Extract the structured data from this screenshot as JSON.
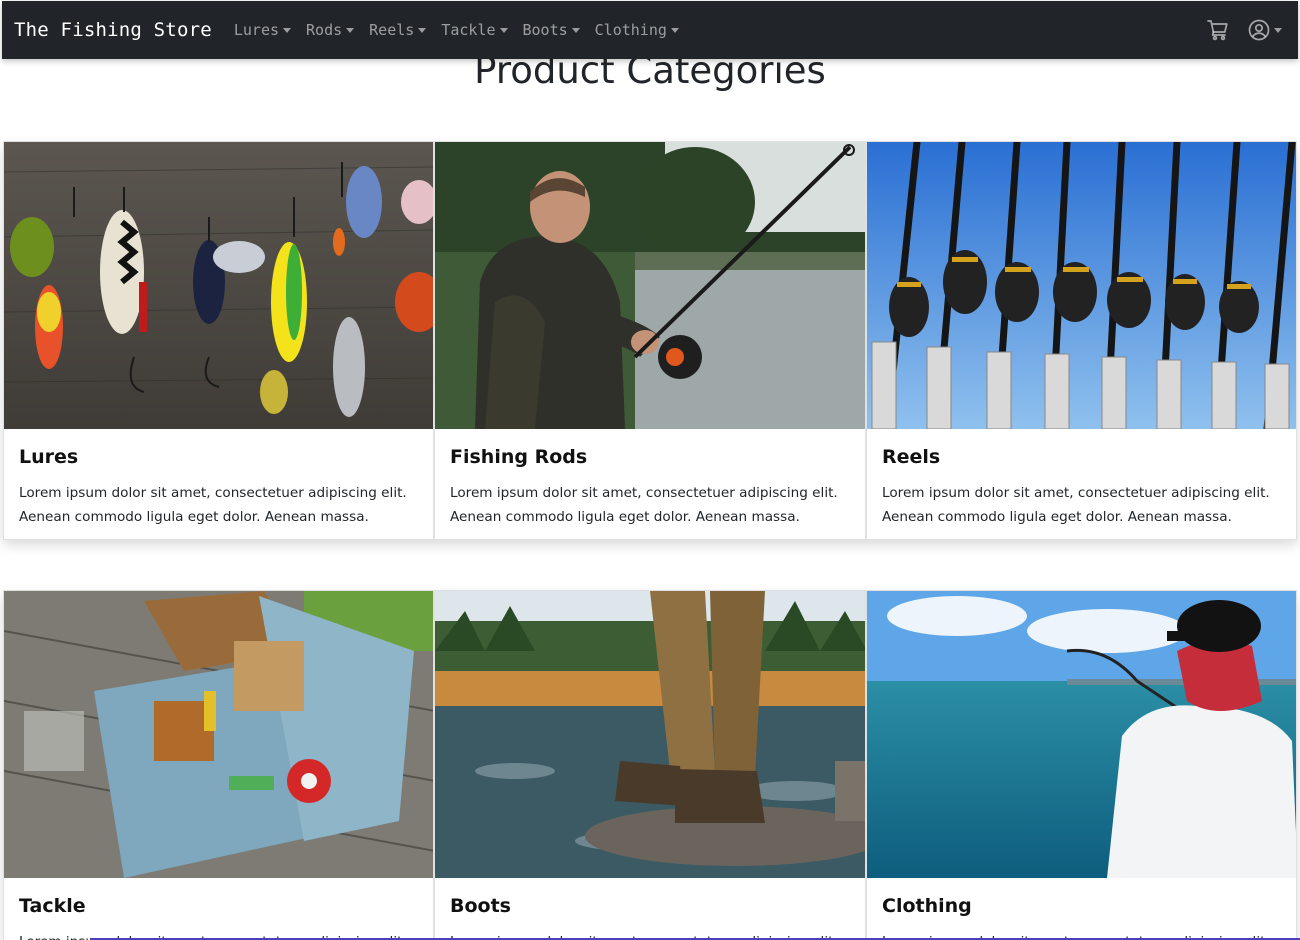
{
  "navbar": {
    "brand": "The Fishing Store",
    "menu": [
      {
        "label": "Lures"
      },
      {
        "label": "Rods"
      },
      {
        "label": "Reels"
      },
      {
        "label": "Tackle"
      },
      {
        "label": "Boots"
      },
      {
        "label": "Clothing"
      }
    ],
    "cart_icon": "cart-icon",
    "account_icon": "user-circle-icon"
  },
  "main": {
    "heading": "Product Categories",
    "categories": [
      {
        "title": "Lures",
        "text": "Lorem ipsum dolor sit amet, consectetuer adipiscing elit. Aenean commodo ligula eget dolor. Aenean massa.",
        "image": "lures-photo"
      },
      {
        "title": "Fishing Rods",
        "text": "Lorem ipsum dolor sit amet, consectetuer adipiscing elit. Aenean commodo ligula eget dolor. Aenean massa.",
        "image": "angler-with-rod-photo"
      },
      {
        "title": "Reels",
        "text": "Lorem ipsum dolor sit amet, consectetuer adipiscing elit. Aenean commodo ligula eget dolor. Aenean massa.",
        "image": "rods-and-reels-photo"
      },
      {
        "title": "Tackle",
        "text": "Lorem ipsum dolor sit amet, consectetuer adipiscing elit. Aenean commodo ligula eget dolor. Aenean massa.",
        "image": "tackle-box-photo"
      },
      {
        "title": "Boots",
        "text": "Lorem ipsum dolor sit amet, consectetuer adipiscing elit. Aenean commodo ligula eget dolor. Aenean massa.",
        "image": "wading-boots-photo"
      },
      {
        "title": "Clothing",
        "text": "Lorem ipsum dolor sit amet, consectetuer adipiscing elit. Aenean commodo ligula eget dolor. Aenean massa.",
        "image": "angler-at-sea-photo"
      }
    ]
  },
  "colors": {
    "navbar_bg": "#212529",
    "nav_link": "rgba(255,255,255,0.55)",
    "brand": "#ffffff"
  }
}
